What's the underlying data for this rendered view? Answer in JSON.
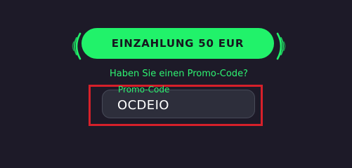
{
  "deposit": {
    "label": "EINZAHLUNG 50 EUR",
    "accent_color": "#21f26a"
  },
  "promo": {
    "question": "Haben Sie einen Promo-Code?",
    "field_label": "Promo-Code",
    "value": "OCDEIO"
  },
  "icons": {
    "left": "sound-wave-left-icon",
    "right": "sound-wave-right-icon"
  },
  "highlight": {
    "color": "#d6202a"
  }
}
